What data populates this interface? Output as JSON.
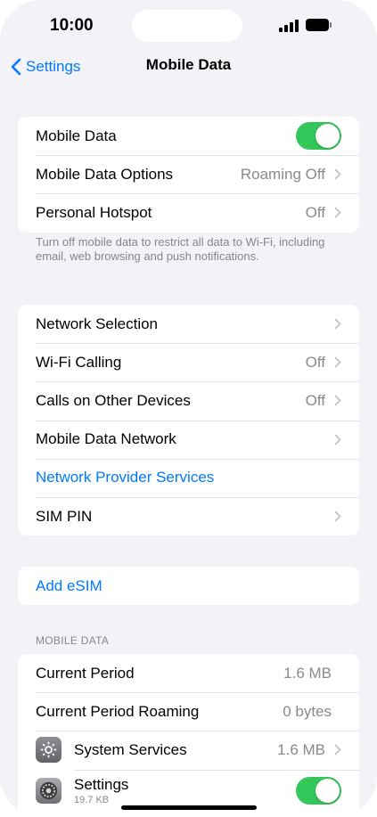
{
  "status_bar": {
    "time": "10:00"
  },
  "nav": {
    "back_label": "Settings",
    "title": "Mobile Data"
  },
  "group1": {
    "mobile_data": {
      "label": "Mobile Data",
      "toggle_on": true
    },
    "mobile_data_options": {
      "label": "Mobile Data Options",
      "value": "Roaming Off"
    },
    "personal_hotspot": {
      "label": "Personal Hotspot",
      "value": "Off"
    },
    "footer": "Turn off mobile data to restrict all data to Wi-Fi, including email, web browsing and push notifications."
  },
  "group2": {
    "network_selection": {
      "label": "Network Selection"
    },
    "wifi_calling": {
      "label": "Wi-Fi Calling",
      "value": "Off"
    },
    "calls_other_devices": {
      "label": "Calls on Other Devices",
      "value": "Off"
    },
    "mobile_data_network": {
      "label": "Mobile Data Network"
    },
    "network_provider_services": {
      "label": "Network Provider Services"
    },
    "sim_pin": {
      "label": "SIM PIN"
    }
  },
  "group3": {
    "add_esim": {
      "label": "Add eSIM"
    }
  },
  "usage": {
    "header": "MOBILE DATA",
    "current_period": {
      "label": "Current Period",
      "value": "1.6 MB"
    },
    "current_period_roaming": {
      "label": "Current Period Roaming",
      "value": "0 bytes"
    },
    "system_services": {
      "label": "System Services",
      "value": "1.6 MB",
      "icon": "system-services-gear-icon"
    },
    "settings_app": {
      "label": "Settings",
      "size": "19.7 KB",
      "toggle_on": true,
      "icon": "settings-gear-icon"
    }
  },
  "colors": {
    "accent": "#007aff",
    "toggle_on": "#34c759",
    "background": "#f2f2f7",
    "secondary_text": "#8a8a8e"
  }
}
